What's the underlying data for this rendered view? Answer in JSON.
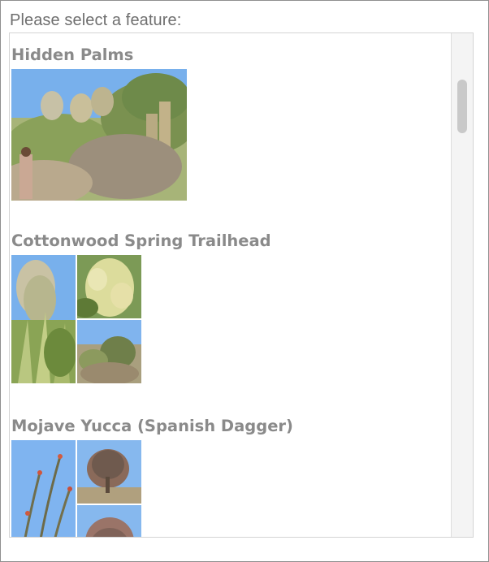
{
  "prompt": "Please select a feature:",
  "features": [
    {
      "title": "Hidden Palms"
    },
    {
      "title": "Cottonwood Spring Trailhead"
    },
    {
      "title": "Mojave Yucca (Spanish Dagger)"
    }
  ],
  "colors": {
    "prompt_text": "#6f6f6f",
    "title_text": "#8a8a8a",
    "sky": "#6ea7ea",
    "vegetation": "#7e9a4a",
    "sand": "#c2aa8a",
    "scrollbar_track": "#f4f4f4",
    "scrollbar_thumb": "#c9c9c9"
  },
  "icons": {
    "photo": "photo-thumbnail",
    "scroll": "scrollbar-thumb"
  }
}
